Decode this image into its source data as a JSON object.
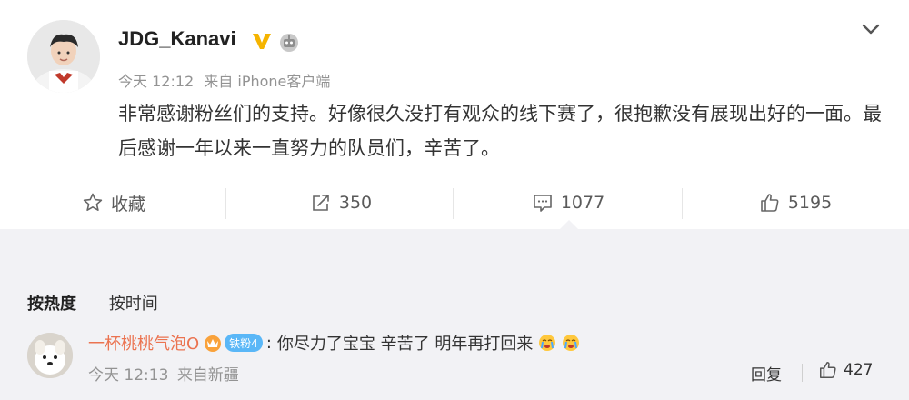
{
  "post": {
    "username": "JDG_Kanavi",
    "time": "今天 12:12",
    "source": "来自 iPhone客户端",
    "content": "非常感谢粉丝们的支持。好像很久没打有观众的线下赛了，很抱歉没有展现出好的一面。最后感谢一年以来一直努力的队员们，辛苦了。"
  },
  "actions": {
    "favorite_label": "收藏",
    "repost_count": "350",
    "comment_count": "1077",
    "like_count": "5195"
  },
  "comments": {
    "sort_hot": "按热度",
    "sort_time": "按时间",
    "items": [
      {
        "username": "一杯桃桃气泡O",
        "fan_badge": "铁粉4",
        "colon": ":",
        "text": "你尽力了宝宝 辛苦了 明年再打回来",
        "time": "今天 12:13",
        "source": "来自新疆",
        "reply_label": "回复",
        "like_count": "427"
      }
    ]
  },
  "colors": {
    "accent_orange": "#eb7350",
    "meta_gray": "#939393",
    "badge_blue": "#5ab7f7",
    "vip_gold": "#f5b400"
  },
  "icons": {
    "verified": "vip-crown-icon",
    "robot": "robot-icon",
    "menu": "chevron-down-icon",
    "favorite": "star-icon",
    "repost": "share-icon",
    "comment": "comment-icon",
    "like": "thumbs-up-icon"
  }
}
